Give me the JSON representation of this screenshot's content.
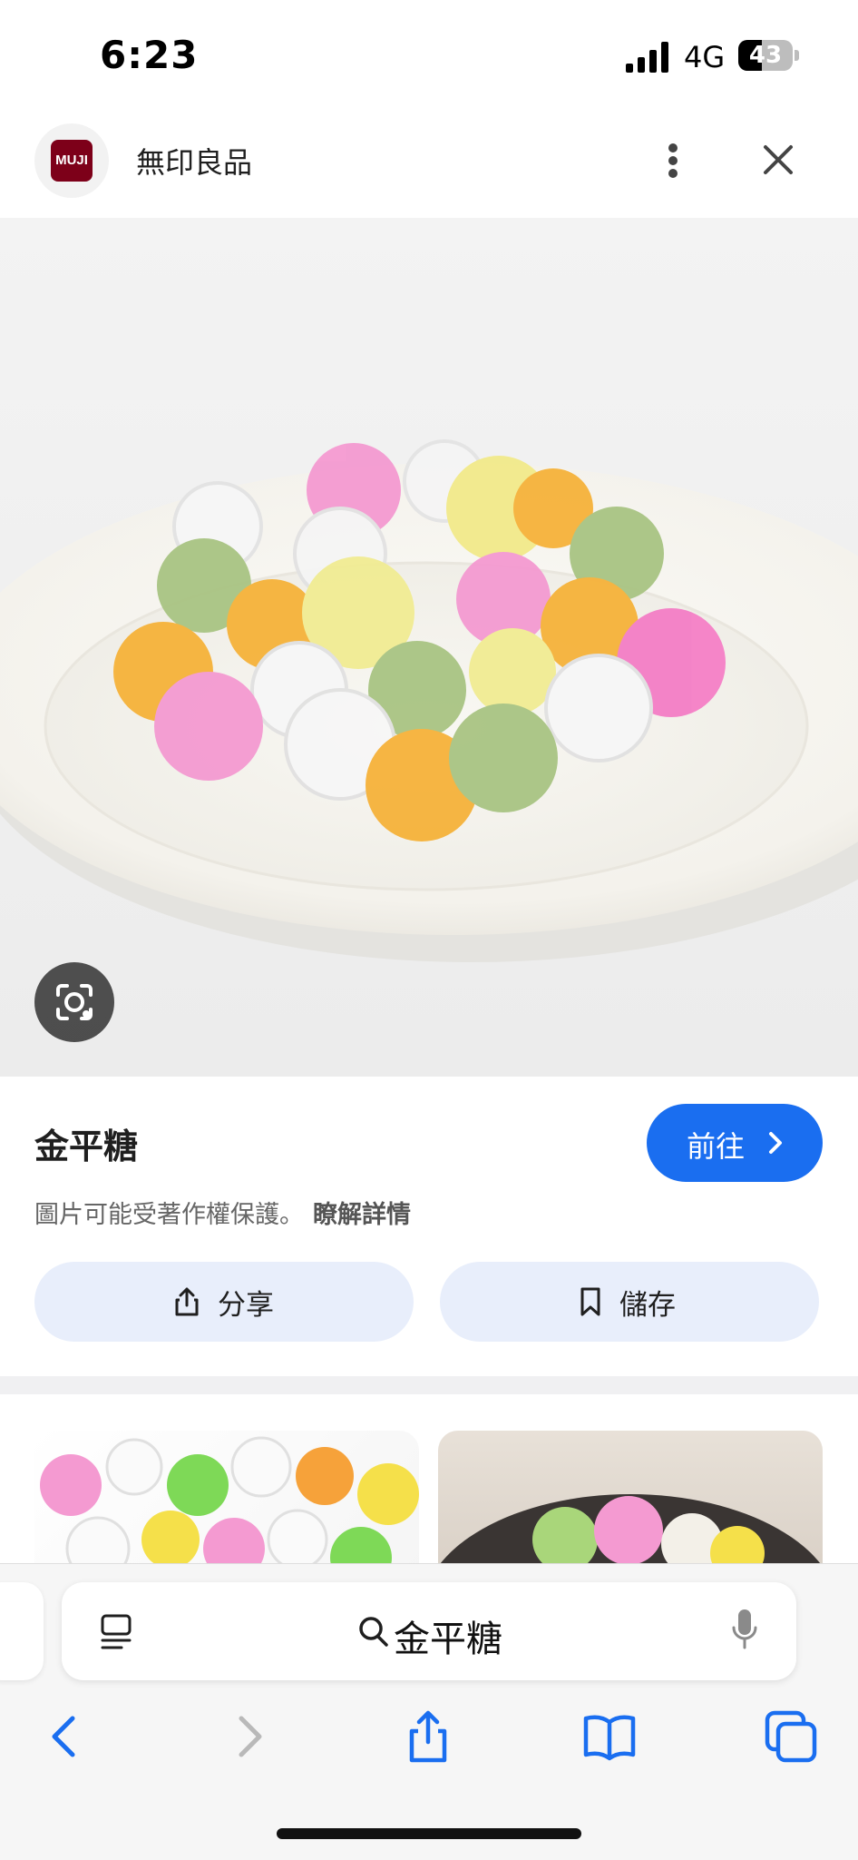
{
  "status_bar": {
    "time": "6:23",
    "network": "4G",
    "battery": "43",
    "battery_level": 0.43
  },
  "header": {
    "site_name": "無印良品",
    "logo_text": "MUJI"
  },
  "image": {
    "title": "金平糖"
  },
  "actions": {
    "visit_label": "前往",
    "copyright_note": "圖片可能受著作權保護。",
    "learn_more": "瞭解詳情",
    "share_label": "分享",
    "save_label": "儲存"
  },
  "safari": {
    "address_text": "金平糖"
  },
  "colors": {
    "accent": "#1a6ef0",
    "pill_bg": "#e8eefb",
    "brand": "#7d0019"
  },
  "icons": {
    "signal": "cellular-signal-icon",
    "battery": "battery-icon",
    "more": "more-vert-icon",
    "close": "close-icon",
    "lens": "lens-icon",
    "share": "share-icon",
    "save": "bookmark-icon",
    "reader": "reader-icon",
    "search": "search-icon",
    "mic": "mic-icon",
    "back": "back-icon",
    "forward": "forward-icon",
    "bookmarks": "bookmarks-icon",
    "tabs": "tabs-icon"
  }
}
